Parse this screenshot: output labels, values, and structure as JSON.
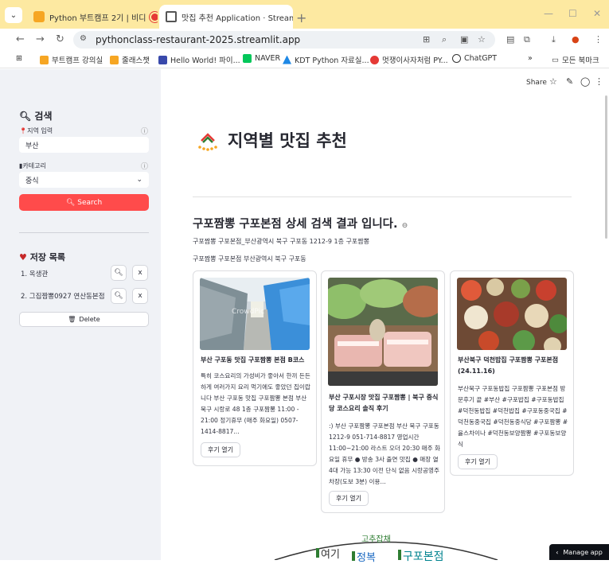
{
  "browser": {
    "tabs": [
      {
        "label": "Python 부트캠프 2기 | 비디"
      },
      {
        "label": "맛집 추천 Application · Stream"
      }
    ],
    "tab_close": "×",
    "new_tab": "+",
    "url": "pythonclass-restaurant-2025.streamlit.app",
    "bookmarks": [
      "부트캠프 강의실",
      "줄래스챗",
      "Hello World! 파이...",
      "NAVER",
      "KDT Python 자료실...",
      "멋쟁이사자처럼 PY...",
      "ChatGPT"
    ],
    "all_bookmarks": "모든 북마크",
    "more": "»"
  },
  "toolbar": {
    "share": "Share"
  },
  "sidebar": {
    "search_title": "검색",
    "region_label": "지역 입력",
    "region_value": "부산",
    "category_label": "카테고리",
    "category_value": "중식",
    "search_button": "Search",
    "saved_title": "저장 목록",
    "saved_items": [
      "1. 옥생관",
      "2. 그집짬뽕0927 연산동본점"
    ],
    "x_label": "x",
    "delete_button": "Delete"
  },
  "main": {
    "app_title": "지역별 맛집 추천",
    "result_title": "구포짬뽕 구포본점 상세 검색 결과 입니다.",
    "address_line1": "구포짬뽕 구포본점_부산광역시 북구 구포동 1212-9 1층 구포짬뽕",
    "address_line2": "구포짬뽕 구포본점 부산광역시 북구 구포동",
    "cards": [
      {
        "title": "부산 구포동 맛집 구포짬뽕 본점 B코스",
        "desc": "특히 코스요리의 가성비가 좋아서 한끼 든든하게 여러가지 요리 먹기에도 좋았던 집이랍니다 부산 구포동 맛집 구포짬뽕 본점 부산 북구 시랑로 48 1층 구포짬뽕 11:00 - 21:00 정기휴무 (매주 화요일) 0507-1414-8817...",
        "button": "후기 열기",
        "watermark": "CrowdPic"
      },
      {
        "title": "부산 구포시장 맛집 구포짬뽕 | 북구 중식당 코스요리 솔직 후기",
        "desc": ":) 부산 구포짬뽕 구포본점 부산 북구 구포동 1212-9 051-714-8817 영업시간 11:00~21:00 라스트 오더 20:30 매주 화요일 휴무 ● 방송 3사 출연 맛집 ● 매장 열 4대 가능 13:30 이전 단식 없음 시랑공영주차장(도보 3분) 이용...",
        "button": "후기 열기"
      },
      {
        "title": "부산북구 덕천밥집 구포짬뽕 구포본점 (24.11.16)",
        "desc": "부산북구 구포동밥집 구포짬뽕 구포본점 방문후기 끝 #부산 #구포밥집 #구포동밥집 #덕천동밥집 #덕천밥집 #구포동중국집 #덕천동중국집 #덕천동중식당 #구포짬뽕 #율스차이나 #덕천동보양짬뽕 #구포동보양식",
        "button": "후기 열기"
      }
    ],
    "wordcloud": [
      "여기",
      "고추잡채",
      "정복",
      "구포본점"
    ]
  },
  "manage_app": "Manage app",
  "colors": {
    "accent": "#ff4b4b",
    "sidebar_bg": "#f0f2f6",
    "tabbar_bg": "#fde9a1"
  }
}
